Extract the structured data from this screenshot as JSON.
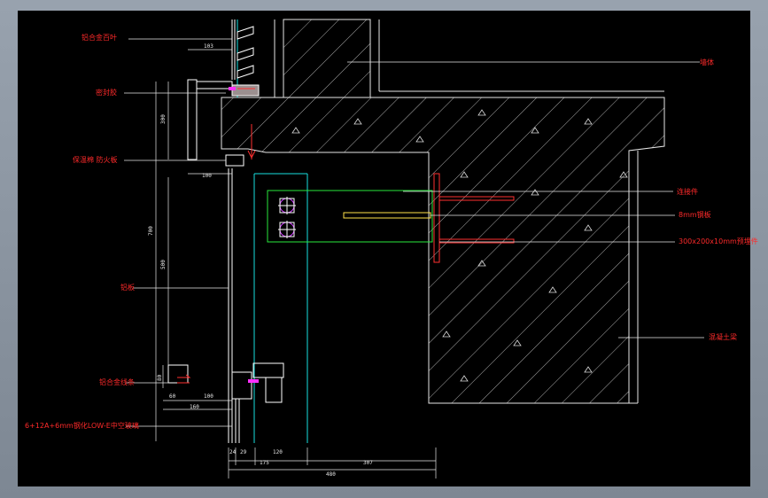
{
  "drawing": {
    "background_color": "#000000",
    "label_color": "#ff2a2a",
    "labels": {
      "louver": "铝合金百叶",
      "sealant": "密封胶",
      "insulation": "保温棉 防火板",
      "aluminum_panel": "铝板",
      "aluminum_line": "铝合金线条",
      "glass": "6+12A+6mm钢化LOW-E中空玻璃",
      "wall": "墙体",
      "connector": "连接件",
      "steel_plate": "8mm钢板",
      "embedded_plate": "300x200x10mm预埋件",
      "concrete": "混凝土梁"
    },
    "dimensions": {
      "d_103": "103",
      "d_300": "300",
      "d_100_top": "100",
      "d_700": "700",
      "d_500": "500",
      "d_80": "80",
      "d_60": "60",
      "d_100_bottom": "100",
      "d_160": "160",
      "d_24": "24",
      "d_29": "29",
      "d_175": "175",
      "d_120": "120",
      "d_307": "307",
      "d_480": "480"
    }
  }
}
